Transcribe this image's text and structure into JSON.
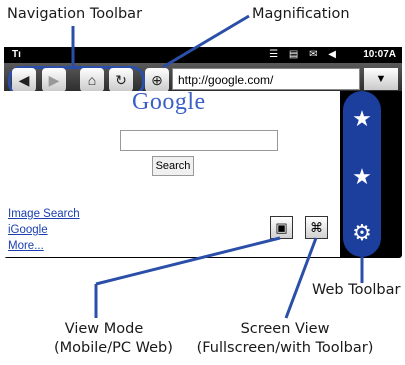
{
  "callouts": {
    "navigation_toolbar": "Navigation Toolbar",
    "magnification": "Magnification",
    "web_toolbar": "Web Toolbar",
    "view_mode_1": "View Mode",
    "view_mode_2": "(Mobile/PC Web)",
    "screen_view_1": "Screen View",
    "screen_view_2": "(Fullscreen/with Toolbar)"
  },
  "status_bar": {
    "signal": "Tı",
    "icons": "☰ ▤ ✉ ◀",
    "time": "10:07A"
  },
  "browser": {
    "url": "http://google.com/",
    "back_icon": "◀",
    "forward_icon": "▶",
    "home_icon": "⌂",
    "refresh_icon": "↻",
    "magnify_icon": "⊕",
    "dropdown_icon": "▼"
  },
  "page": {
    "logo": "Google",
    "search_button": "Search",
    "links": [
      "Image Search",
      "iGoogle",
      "More..."
    ]
  },
  "view_buttons": {
    "view_mode_icon": "▣",
    "screen_view_icon": "⌘"
  },
  "web_toolbar": {
    "add_bookmark_icon": "★",
    "bookmarks_icon": "★",
    "settings_icon": "⚙"
  },
  "colors": {
    "callout_line": "#2b4fa8",
    "link": "#1a3fb0",
    "toolbar_blue": "#1c3f9e"
  }
}
